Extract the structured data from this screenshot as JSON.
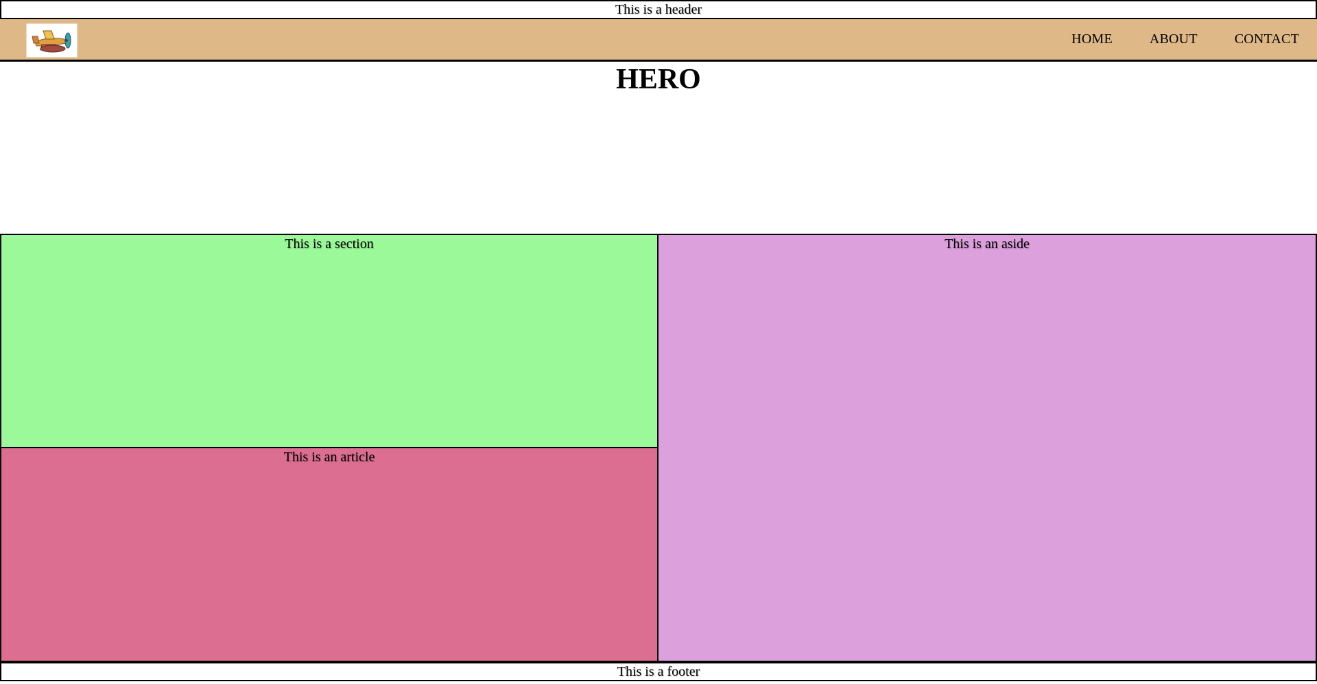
{
  "header": {
    "text": "This is a header"
  },
  "navbar": {
    "logo": "airplane-logo",
    "links": [
      {
        "label": "HOME"
      },
      {
        "label": "ABOUT"
      },
      {
        "label": "CONTACT"
      }
    ]
  },
  "hero": {
    "title": "HERO"
  },
  "section": {
    "text": "This is a section"
  },
  "article": {
    "text": "This is an article"
  },
  "aside": {
    "text": "This is an aside"
  },
  "footer": {
    "text": "This is a footer"
  },
  "colors": {
    "navbar_bg": "#dfb887",
    "section_bg": "#9cf99a",
    "article_bg": "#dc6f91",
    "aside_bg": "#dca0dc",
    "border": "#000000"
  }
}
